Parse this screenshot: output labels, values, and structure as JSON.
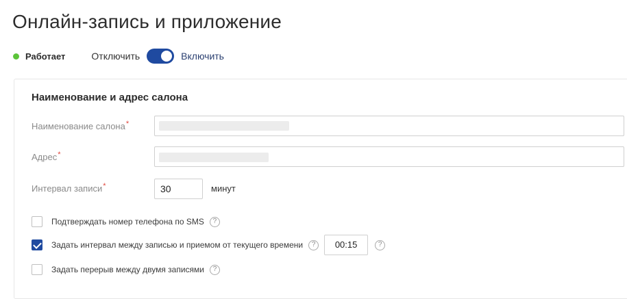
{
  "page": {
    "title": "Онлайн-запись и приложение"
  },
  "status": {
    "text": "Работает",
    "toggle_off_label": "Отключить",
    "toggle_on_label": "Включить",
    "toggle_state": "on",
    "dot_color": "#5cc43a",
    "toggle_color": "#1f4aa0"
  },
  "section": {
    "title": "Наименование и адрес салона",
    "fields": {
      "name": {
        "label": "Наименование салона",
        "required_mark": "*"
      },
      "address": {
        "label": "Адрес",
        "required_mark": "*"
      },
      "interval": {
        "label": "Интервал записи",
        "required_mark": "*",
        "value": "30",
        "unit": "минут"
      }
    },
    "options": [
      {
        "label": "Подтверждать номер телефона по SMS",
        "checked": false,
        "help": "?"
      },
      {
        "label": "Задать интервал между записью и приемом от текущего времени",
        "checked": true,
        "help": "?",
        "time_value": "00:15",
        "time_help": "?"
      },
      {
        "label": "Задать перерыв между двумя записями",
        "checked": false,
        "help": "?"
      }
    ]
  }
}
